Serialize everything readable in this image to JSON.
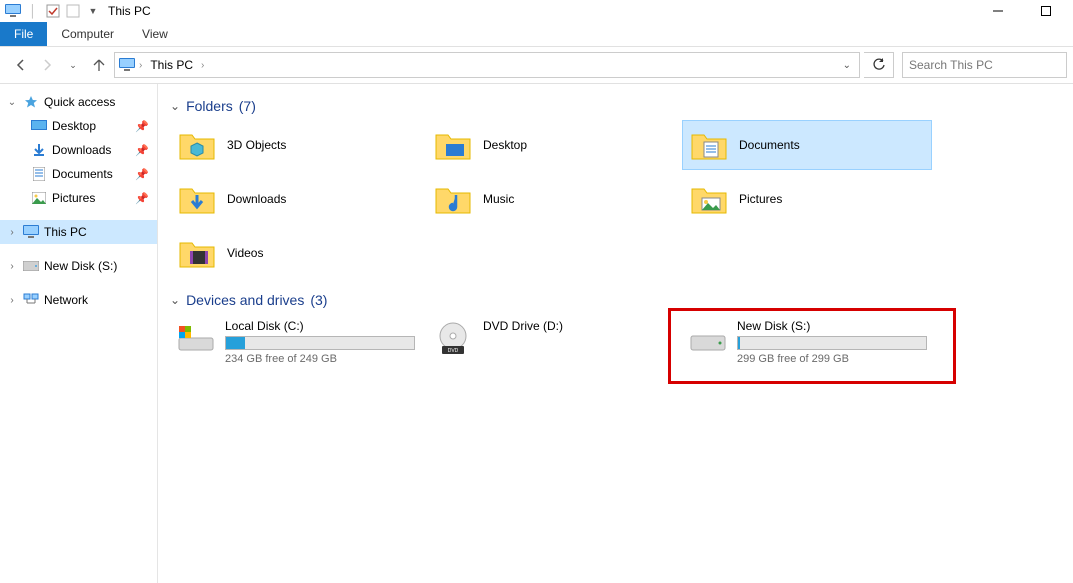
{
  "window": {
    "title": "This PC"
  },
  "ribbon": {
    "file": "File",
    "computer": "Computer",
    "view": "View"
  },
  "nav": {
    "location": "This PC",
    "search_placeholder": "Search This PC"
  },
  "sidebar": {
    "quick_access": {
      "label": "Quick access"
    },
    "items": [
      {
        "label": "Desktop"
      },
      {
        "label": "Downloads"
      },
      {
        "label": "Documents"
      },
      {
        "label": "Pictures"
      }
    ],
    "this_pc": {
      "label": "This PC"
    },
    "new_disk": {
      "label": "New Disk (S:)"
    },
    "network": {
      "label": "Network"
    }
  },
  "content": {
    "folders_header": "Folders",
    "folders_count": "(7)",
    "folders": [
      {
        "label": "3D Objects"
      },
      {
        "label": "Desktop"
      },
      {
        "label": "Documents"
      },
      {
        "label": "Downloads"
      },
      {
        "label": "Music"
      },
      {
        "label": "Pictures"
      },
      {
        "label": "Videos"
      }
    ],
    "drives_header": "Devices and drives",
    "drives_count": "(3)",
    "drives": [
      {
        "label": "Local Disk (C:)",
        "free": "234 GB free of 249 GB",
        "used_pct": 10
      },
      {
        "label": "DVD Drive (D:)"
      },
      {
        "label": "New Disk (S:)",
        "free": "299 GB free of 299 GB",
        "used_pct": 1
      }
    ]
  }
}
